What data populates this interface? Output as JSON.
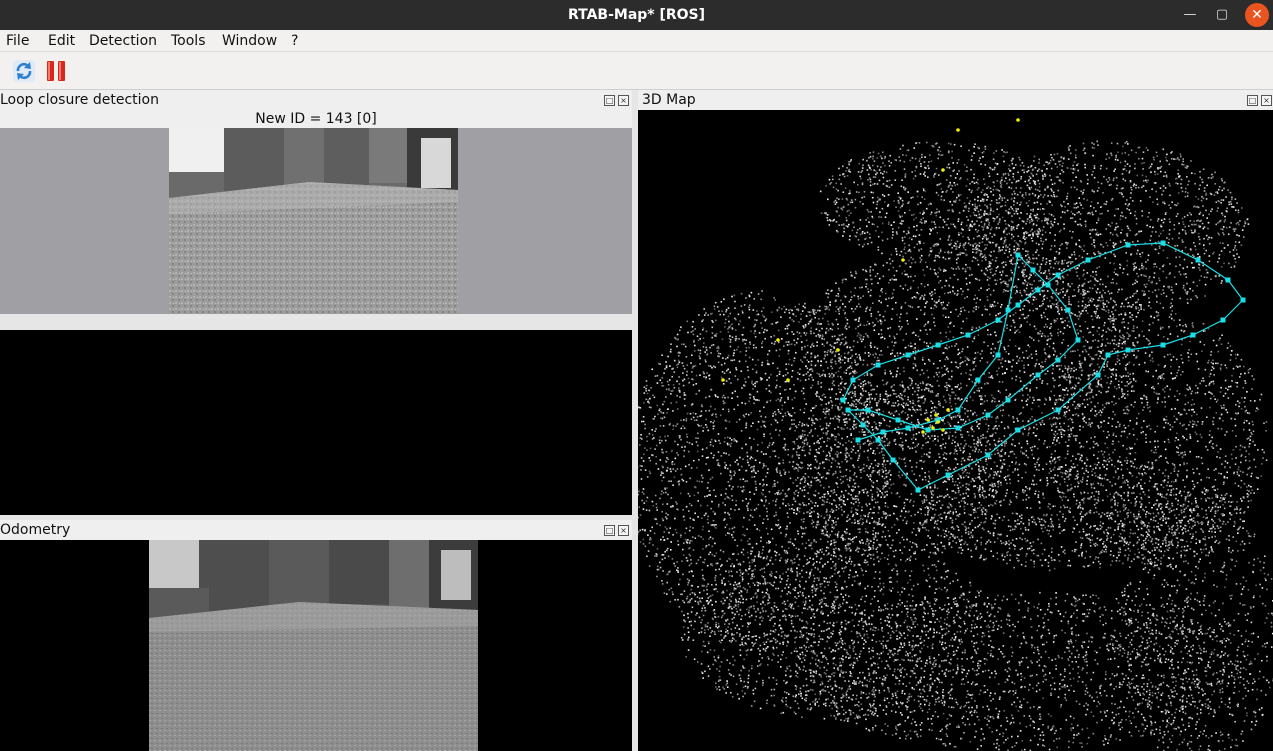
{
  "window": {
    "title": "RTAB-Map* [ROS]",
    "minimize_icon": "minimize-icon",
    "maximize_icon": "maximize-icon",
    "close_icon": "close-icon",
    "close_color": "#e9541f"
  },
  "menubar": {
    "items": [
      "File",
      "Edit",
      "Detection",
      "Tools",
      "Window",
      "?"
    ]
  },
  "toolbar": {
    "tools": [
      {
        "icon": "refresh-icon",
        "color": "#2f7fd0"
      },
      {
        "icon": "pause-icon",
        "color": "#d6281f"
      }
    ]
  },
  "loop_panel": {
    "title": "Loop closure detection",
    "new_id_text": "New ID = 143 [0]",
    "float_icon": "float-icon",
    "close_icon": "close-icon"
  },
  "odometry_panel": {
    "title": "Odometry",
    "float_icon": "float-icon",
    "close_icon": "close-icon"
  },
  "map_panel": {
    "title": "3D Map",
    "float_icon": "float-icon",
    "close_icon": "close-icon",
    "trajectory_color": "#18e0e8",
    "feature_color": "#f2f200"
  }
}
